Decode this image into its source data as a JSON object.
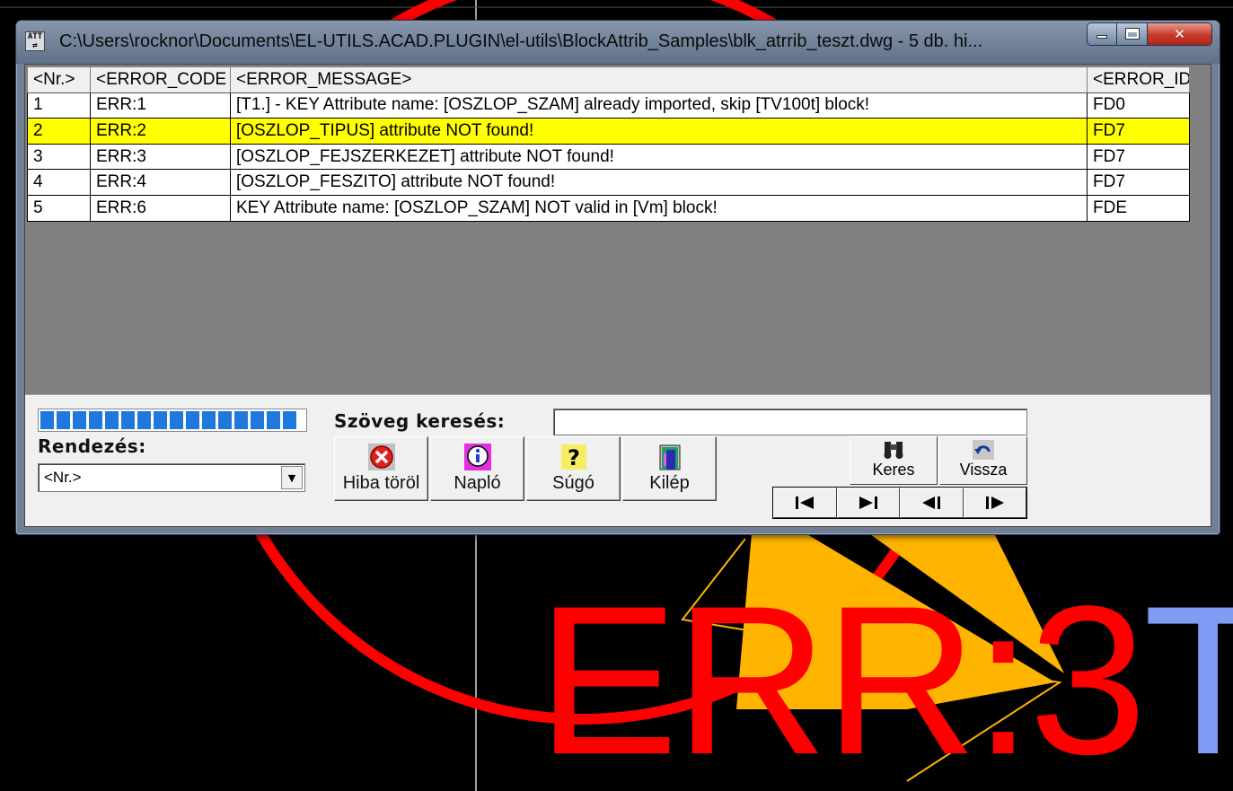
{
  "window": {
    "title": "C:\\Users\\rocknor\\Documents\\EL-UTILS.ACAD.PLUGIN\\el-utils\\BlockAttrib_Samples\\blk_atrrib_teszt.dwg -  5 db. hi...",
    "icon_text": "ATT"
  },
  "grid": {
    "columns": [
      "<Nr.>",
      "<ERROR_CODE",
      "<ERROR_MESSAGE>",
      "<ERROR_ID"
    ],
    "rows": [
      {
        "nr": "1",
        "code": "ERR:1",
        "message": "[T1.] - KEY Attribute name: [OSZLOP_SZAM] already imported, skip [TV100t] block!",
        "id": "FD0"
      },
      {
        "nr": "2",
        "code": "ERR:2",
        "message": "[OSZLOP_TIPUS] attribute NOT found!",
        "id": "FD7"
      },
      {
        "nr": "3",
        "code": "ERR:3",
        "message": "[OSZLOP_FEJSZERKEZET] attribute NOT found!",
        "id": "FD7"
      },
      {
        "nr": "4",
        "code": "ERR:4",
        "message": "[OSZLOP_FESZITO] attribute NOT found!",
        "id": "FD7"
      },
      {
        "nr": "5",
        "code": "ERR:6",
        "message": "KEY Attribute name: [OSZLOP_SZAM] NOT valid in [Vm] block!",
        "id": "FDE"
      }
    ],
    "selected_row": 1,
    "selected_color": "#ffff00"
  },
  "panel": {
    "sort_label": "Rendezés:",
    "sort_value": "<Nr.>",
    "search_label": "Szöveg keresés:",
    "search_value": "",
    "buttons": {
      "delete": "Hiba töröl",
      "log": "Napló",
      "help": "Súgó",
      "exit": "Kilép",
      "find": "Keres",
      "back": "Vissza"
    },
    "progress_fraction": 1.0
  },
  "cad": {
    "big_text": "ERR:3",
    "big_text_tail": "T",
    "text_color": "#ff0000",
    "tail_color": "#7f9cf5",
    "triangle_color": "#ffb400"
  }
}
